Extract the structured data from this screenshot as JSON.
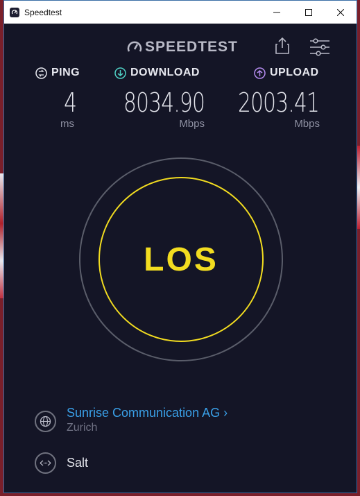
{
  "window": {
    "title": "Speedtest",
    "controls": [
      "minimize",
      "maximize",
      "close"
    ]
  },
  "header": {
    "logo_text": "SPEEDTEST",
    "icons": [
      "speedometer-icon",
      "share-icon",
      "settings-sliders-icon"
    ]
  },
  "metrics": {
    "ping": {
      "label": "PING",
      "value": "4",
      "unit": "ms",
      "icon": "ping-icon",
      "color": "#e8e9f0"
    },
    "download": {
      "label": "DOWNLOAD",
      "value": "8034.90",
      "unit": "Mbps",
      "icon": "download-arrow-icon",
      "color": "#4fd1c5"
    },
    "upload": {
      "label": "UPLOAD",
      "value": "2003.41",
      "unit": "Mbps",
      "icon": "upload-arrow-icon",
      "color": "#b58cf0"
    }
  },
  "go_button": {
    "label": "LOS",
    "color": "#f2dc20"
  },
  "provider": {
    "name": "Sunrise Communication AG",
    "chevron": "›",
    "location": "Zurich",
    "icon": "globe-icon",
    "color": "#3aa0e8"
  },
  "server": {
    "name": "Salt",
    "icon": "server-connection-icon"
  }
}
